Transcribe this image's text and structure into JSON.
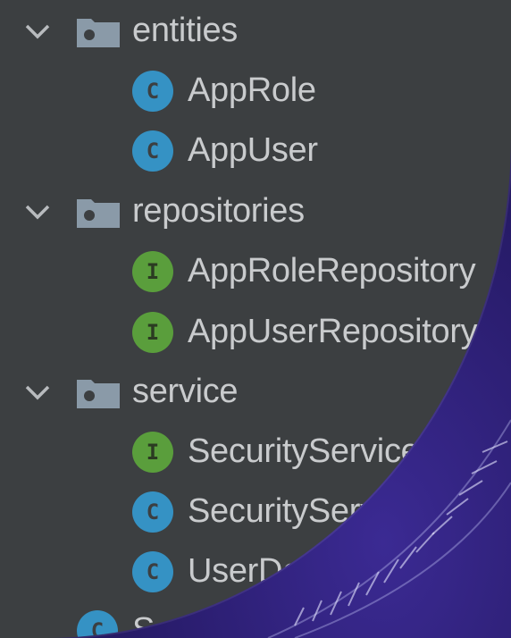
{
  "tree": {
    "nodes": [
      {
        "kind": "folder",
        "label": "entities",
        "expanded": true
      },
      {
        "kind": "class",
        "icon": "C",
        "label": "AppRole"
      },
      {
        "kind": "class",
        "icon": "C",
        "label": "AppUser"
      },
      {
        "kind": "folder",
        "label": "repositories",
        "expanded": true
      },
      {
        "kind": "interface",
        "icon": "I",
        "label": "AppRoleRepository"
      },
      {
        "kind": "interface",
        "icon": "I",
        "label": "AppUserRepository"
      },
      {
        "kind": "folder",
        "label": "service",
        "expanded": true
      },
      {
        "kind": "interface",
        "icon": "I",
        "label": "SecurityService"
      },
      {
        "kind": "class",
        "icon": "C",
        "label": "SecurityServic"
      },
      {
        "kind": "class",
        "icon": "C",
        "label": "UserDeta"
      },
      {
        "kind": "class",
        "icon": "C",
        "label": "Sec"
      }
    ]
  },
  "colors": {
    "panel_bg": "#3c3f41",
    "class_badge": "#3592c4",
    "interface_badge": "#5a9e3c",
    "folder": "#8a9aa8",
    "text": "#c9cbcd",
    "background": "#2a1d6e"
  }
}
